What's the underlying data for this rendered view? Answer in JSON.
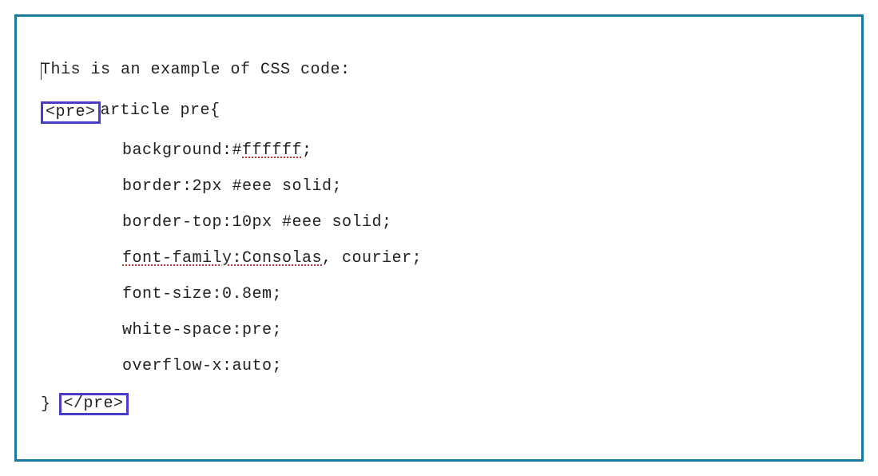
{
  "intro": "This is an example of CSS code:",
  "pre_open": "<pre>",
  "selector": "article pre{",
  "lines": {
    "l1_prefix": "background:#",
    "l1_spell": "ffffff",
    "l1_suffix": ";",
    "l2": "border:2px #eee solid;",
    "l3": "border-top:10px #eee solid;",
    "l4_spell": "font-family:Consolas",
    "l4_suffix": ", courier;",
    "l5": "font-size:0.8em;",
    "l6": "white-space:pre;",
    "l7": "overflow-x:auto;"
  },
  "close_brace": "}",
  "pre_close": "</pre>"
}
